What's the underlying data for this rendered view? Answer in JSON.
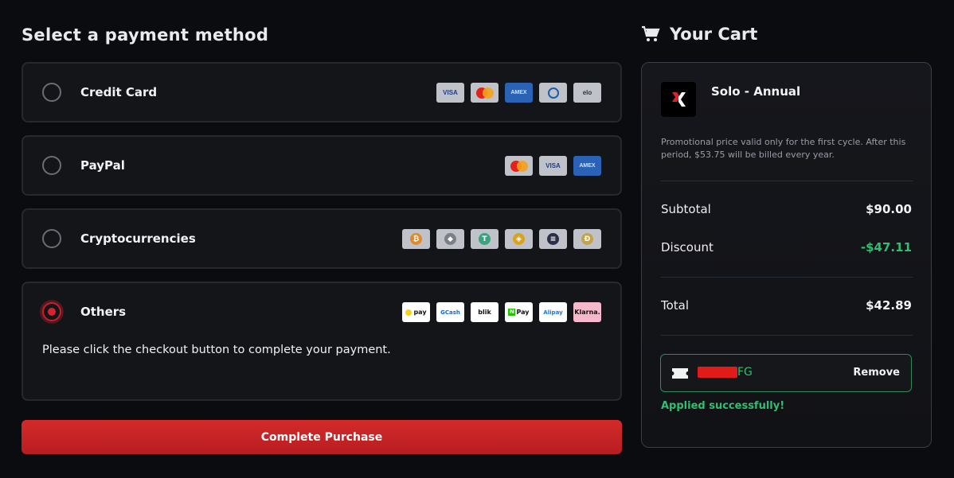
{
  "payment": {
    "title": "Select a payment method",
    "methods": [
      {
        "label": "Credit Card",
        "selected": false,
        "icons": [
          "VISA",
          "mastercard",
          "AMEX",
          "diners",
          "elo"
        ]
      },
      {
        "label": "PayPal",
        "selected": false,
        "icons": [
          "mastercard",
          "VISA",
          "AMEX"
        ]
      },
      {
        "label": "Cryptocurrencies",
        "selected": false,
        "icons": [
          "bitcoin",
          "ethereum",
          "tether",
          "binance",
          "solana",
          "dogecoin"
        ]
      },
      {
        "label": "Others",
        "selected": true,
        "icons": [
          "pay",
          "GCash",
          "blik",
          "Pay",
          "Alipay",
          "Klarna."
        ],
        "note": "Please click the checkout button to complete your payment."
      }
    ],
    "complete_label": "Complete Purchase"
  },
  "cart": {
    "title": "Your Cart",
    "product": {
      "name": "Solo - Annual",
      "promo": "Promotional price valid only for the first cycle. After this period, $53.75 will be billed every year."
    },
    "subtotal_label": "Subtotal",
    "subtotal_value": "$90.00",
    "discount_label": "Discount",
    "discount_value": "-$47.11",
    "total_label": "Total",
    "total_value": "$42.89",
    "coupon_suffix": "FG",
    "remove_label": "Remove",
    "applied_text": "Applied successfully!"
  },
  "colors": {
    "accent": "#c8202a",
    "success": "#2fbf71",
    "background": "#0b0c0f"
  }
}
